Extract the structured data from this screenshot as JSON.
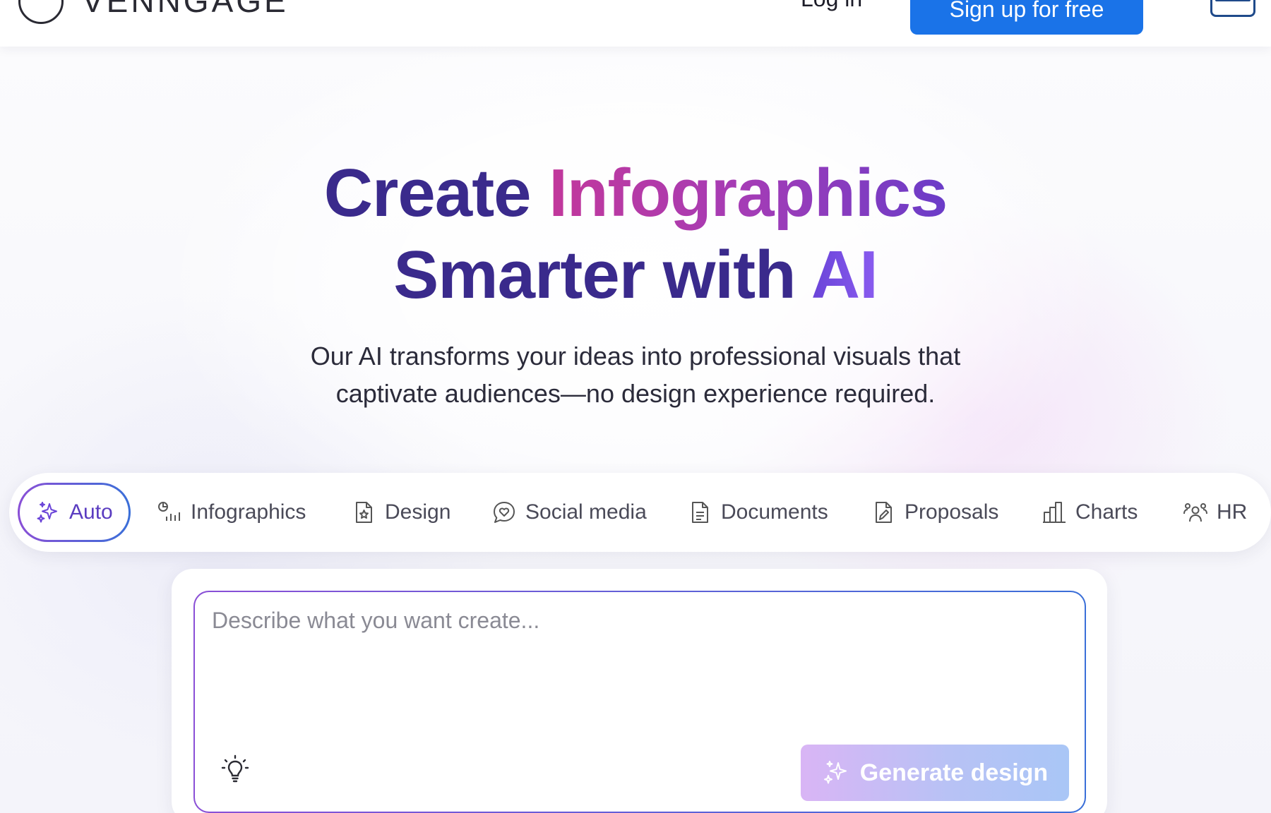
{
  "header": {
    "logo_text": "VENNGAGE",
    "login_label": "Log in",
    "signup_label": "Sign up for free"
  },
  "hero": {
    "title_part1": "Create ",
    "title_highlight1": "Infographics",
    "title_part2": "Smarter with ",
    "title_highlight2": "AI",
    "subtitle_line1": "Our AI transforms your ideas into professional visuals that",
    "subtitle_line2": "captivate audiences—no design experience required."
  },
  "tabs": [
    {
      "label": "Auto",
      "icon": "sparkle-icon",
      "active": true
    },
    {
      "label": "Infographics",
      "icon": "infographic-icon",
      "active": false
    },
    {
      "label": "Design",
      "icon": "design-doc-icon",
      "active": false
    },
    {
      "label": "Social media",
      "icon": "chat-heart-icon",
      "active": false
    },
    {
      "label": "Documents",
      "icon": "document-icon",
      "active": false
    },
    {
      "label": "Proposals",
      "icon": "proposal-icon",
      "active": false
    },
    {
      "label": "Charts",
      "icon": "bar-chart-icon",
      "active": false
    },
    {
      "label": "HR",
      "icon": "people-icon",
      "active": false
    }
  ],
  "prompt": {
    "placeholder": "Describe what you want create...",
    "generate_label": "Generate design"
  },
  "colors": {
    "accent_blue": "#1a73e8",
    "title_purple": "#3a2a8c",
    "highlight_pink": "#c2389b",
    "highlight_violet": "#6a44d8"
  }
}
